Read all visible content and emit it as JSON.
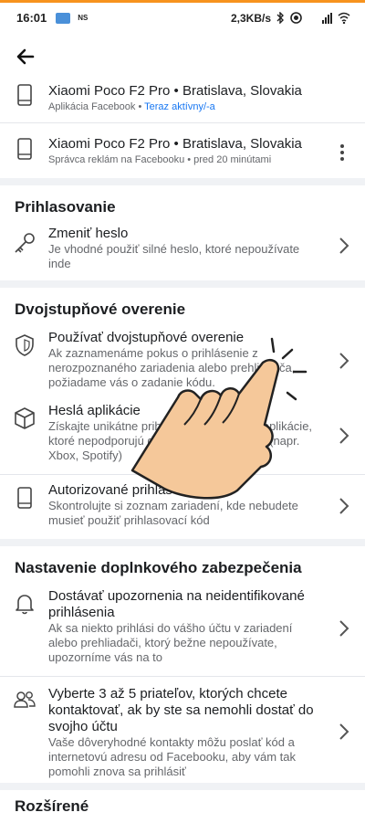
{
  "status_bar": {
    "time": "16:01",
    "ns_label": "NS",
    "speed": "2,3KB/s",
    "icons": [
      "image-icon",
      "bluetooth-icon",
      "alarm-icon",
      "signal-icon",
      "wifi-icon"
    ]
  },
  "colors": {
    "accent": "#1877f2",
    "status_top": "#f7931e"
  },
  "devices": [
    {
      "name": "Xiaomi Poco F2 Pro • Bratislava, Slovakia",
      "source": "Aplikácia Facebook",
      "separator": " • ",
      "status": "Teraz aktívny/-a"
    },
    {
      "name": "Xiaomi Poco F2 Pro • Bratislava, Slovakia",
      "source": "Správca reklám na Facebooku",
      "separator": " • ",
      "status": "pred 20 minútami"
    }
  ],
  "login": {
    "header": "Prihlasovanie",
    "items": [
      {
        "title": "Zmeniť heslo",
        "subtitle": "Je vhodné použiť silné heslo, ktoré nepoužívate inde"
      }
    ]
  },
  "two_factor": {
    "header": "Dvojstupňové overenie",
    "items": [
      {
        "title": "Používať dvojstupňové overenie",
        "subtitle": "Ak zaznamenáme pokus o prihlásenie z nerozpoznaného zariadenia alebo prehliadača, požiadame vás o zadanie kódu."
      },
      {
        "title": "Heslá aplikácie",
        "subtitle": "Získajte unikátne prihlasovacie kódy pre aplikácie, ktoré nepodporujú dvojstupňové overenie (napr. Xbox, Spotify)"
      },
      {
        "title": "Autorizované prihlásenia",
        "subtitle": "Skontrolujte si zoznam zariadení, kde nebudete musieť použiť prihlasovací kód"
      }
    ]
  },
  "extra_security": {
    "header": "Nastavenie doplnkového zabezpečenia",
    "items": [
      {
        "title": "Dostávať upozornenia na neidentifikované prihlásenia",
        "subtitle": "Ak sa niekto prihlási do vášho účtu v zariadení alebo prehliadači, ktorý bežne nepoužívate, upozorníme vás na to"
      },
      {
        "title": "Vyberte 3 až 5 priateľov, ktorých chcete kontaktovať, ak by ste sa nemohli dostať do svojho účtu",
        "subtitle": "Vaše dôveryhodné kontakty môžu poslať kód a internetovú adresu od Facebooku, aby vám tak pomohli znova sa prihlásiť"
      }
    ]
  },
  "advanced": {
    "header": "Rozšírené"
  }
}
